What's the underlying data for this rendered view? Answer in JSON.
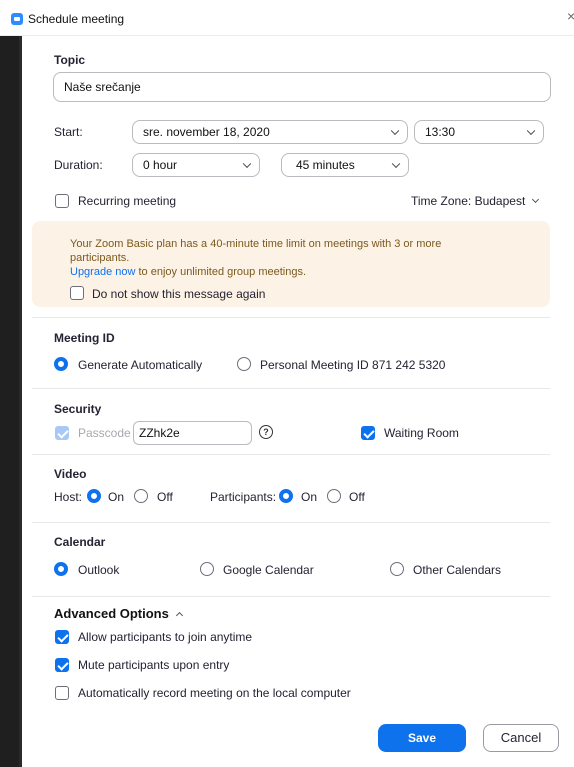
{
  "window": {
    "title": "Schedule meeting",
    "close_glyph": "×"
  },
  "topic": {
    "label": "Topic",
    "value": "Naše srečanje"
  },
  "start": {
    "label": "Start:",
    "date": "sre.  november  18,  2020",
    "time": "13:30"
  },
  "duration": {
    "label": "Duration:",
    "hours": "0 hour",
    "minutes": "45 minutes"
  },
  "recurring": {
    "label": "Recurring meeting",
    "checked": false
  },
  "timezone": {
    "label": "Time Zone: Budapest"
  },
  "notice": {
    "line1": "Your Zoom Basic plan has a 40-minute time limit on meetings with 3 or more",
    "line2": "participants.",
    "link": "Upgrade now",
    "line3": " to enjoy unlimited group meetings.",
    "dismiss_label": "Do not show this message again"
  },
  "meeting_id": {
    "label": "Meeting ID",
    "auto_label": "Generate Automatically",
    "personal_label": "Personal Meeting ID 871 242 5320",
    "selected": "auto"
  },
  "security": {
    "label": "Security",
    "passcode_label": "Passcode",
    "passcode_value": "ZZhk2e",
    "help_glyph": "?",
    "waiting_room_label": "Waiting Room"
  },
  "video": {
    "label": "Video",
    "host_label": "Host:",
    "participants_label": "Participants:",
    "on_label": "On",
    "off_label": "Off"
  },
  "calendar": {
    "label": "Calendar",
    "options": [
      "Outlook",
      "Google Calendar",
      "Other Calendars"
    ],
    "selected": "Outlook"
  },
  "advanced": {
    "label": "Advanced Options",
    "options": [
      {
        "label": "Allow participants to join anytime",
        "checked": true
      },
      {
        "label": "Mute participants upon entry",
        "checked": true
      },
      {
        "label": "Automatically record meeting on the local computer",
        "checked": false
      }
    ]
  },
  "buttons": {
    "save": "Save",
    "cancel": "Cancel"
  },
  "colors": {
    "accent": "#0e72ed",
    "notice_bg": "#fdf2e6",
    "notice_text": "#7a5a1e"
  }
}
